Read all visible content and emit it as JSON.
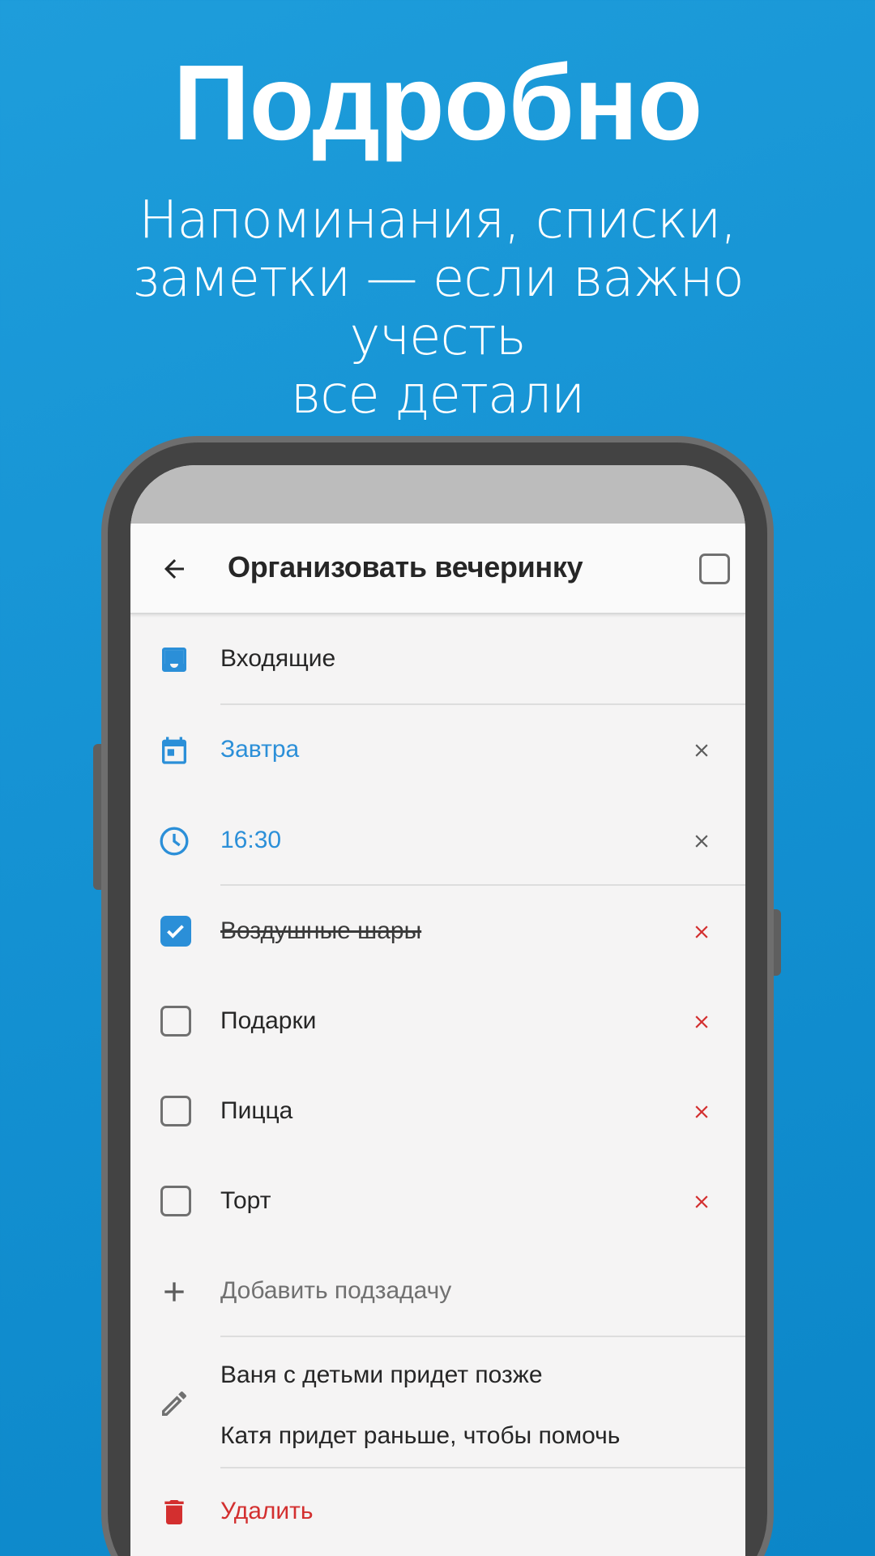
{
  "promo": {
    "title": "Подробно",
    "subtitle_line1": "Напоминания, списки,",
    "subtitle_line2": "заметки — если важно учесть",
    "subtitle_line3": "все детали"
  },
  "appbar": {
    "title": "Организовать вечеринку"
  },
  "task": {
    "list": "Входящие",
    "date": "Завтра",
    "time": "16:30",
    "subtasks": [
      {
        "label": "Воздушные шары",
        "done": true
      },
      {
        "label": "Подарки",
        "done": false
      },
      {
        "label": "Пицца",
        "done": false
      },
      {
        "label": "Торт",
        "done": false
      }
    ],
    "add_subtask": "Добавить подзадачу",
    "note_line1": "Ваня с детьми придет позже",
    "note_line2": "Катя придет раньше, чтобы помочь",
    "delete": "Удалить"
  },
  "colors": {
    "accent": "#2b8fd8",
    "danger": "#d32f2f",
    "background": "#1592d3"
  },
  "icons": {
    "back": "arrow-left-icon",
    "list": "inbox-icon",
    "date": "calendar-icon",
    "time": "clock-icon",
    "clear": "close-icon",
    "remove": "close-red-icon",
    "add": "plus-icon",
    "note": "pencil-icon",
    "delete": "trash-icon"
  }
}
